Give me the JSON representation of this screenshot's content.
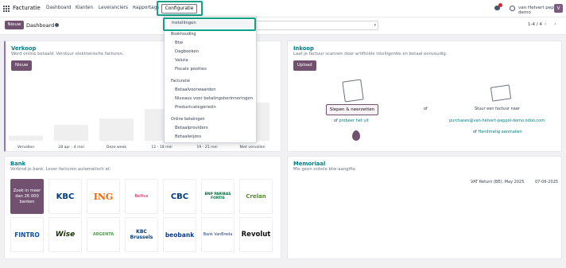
{
  "navbar": {
    "app_name": "Facturatie",
    "menu": [
      "Dashboard",
      "Klanten",
      "Leveranciers",
      "Rapportage",
      "Configuratie"
    ],
    "user": "van Helvert peppol demo",
    "avatar_letter": "V",
    "chat_badge": "1"
  },
  "control": {
    "new_label": "Nieuw",
    "title": "Dashboard",
    "pager": "1-4 / 4",
    "pager_arrows": "‹ ›"
  },
  "dropdown": {
    "first_item": "Instellingen",
    "sections": [
      {
        "header": "Boekhouding",
        "items": [
          "Btw",
          "Dagboeken",
          "Valuta",
          "Fiscale posities"
        ]
      },
      {
        "header": "Facturatie",
        "items": [
          "Betaalvoorwaarden",
          "Niveaus voor betalingsherinneringen",
          "Productcategorieën"
        ]
      },
      {
        "header": "Online betalingen",
        "items": [
          "Betaalproviders",
          "Betaalwijzes"
        ]
      }
    ]
  },
  "verkoop": {
    "title": "Verkoop",
    "subtitle": "Word online betaald. Verstuur elektronische facturen.",
    "button": "Nieuw",
    "chart_data": {
      "type": "bar",
      "categories": [
        "Vervallen",
        "28 apr - 4 mei",
        "Deze week",
        "12 - 18 mei",
        "19 - 25 mei",
        "Niet vervallen"
      ],
      "values": [
        8,
        25,
        35,
        50,
        30,
        60
      ],
      "title": "",
      "xlabel": "",
      "ylabel": "",
      "ylim": [
        0,
        100
      ]
    }
  },
  "inkoop": {
    "title": "Inkoop",
    "subtitle": "Laat je factuur scannen door artificiële intelligentie en betaal eenvoudig.",
    "button": "Upload",
    "drop_label": "Slepen & neerzetten",
    "or_label": "of",
    "try_or": "of",
    "try_link": "probeer het uit",
    "mail_label": "Stuur een factuur naar",
    "mail_address": "purchases@van-helvert-peppol-demo.odoo.com",
    "manual_or": "of",
    "manual_link": "Handmatig aanmaken"
  },
  "bank": {
    "title": "Bank",
    "subtitle": "Verbind je bank. Lever facturen automatisch af.",
    "search_tile": "Zoek in meer dan 26 000 banken",
    "banks": [
      "KBC",
      "ING",
      "Belfius",
      "CBC",
      "BNP PARIBAS FORTIS",
      "Crelan",
      "FINTRO",
      "Wise",
      "ARGENTA",
      "KBC Brussels",
      "beobank",
      "Bank VanBreda",
      "Revolut"
    ]
  },
  "memoriaal": {
    "title": "Memoriaal",
    "subtitle": "Mis geen enkele btw-aangifte.",
    "rows": [
      {
        "label": "VAT Return (BE): May 2025",
        "date": "07-06-2025"
      }
    ]
  }
}
